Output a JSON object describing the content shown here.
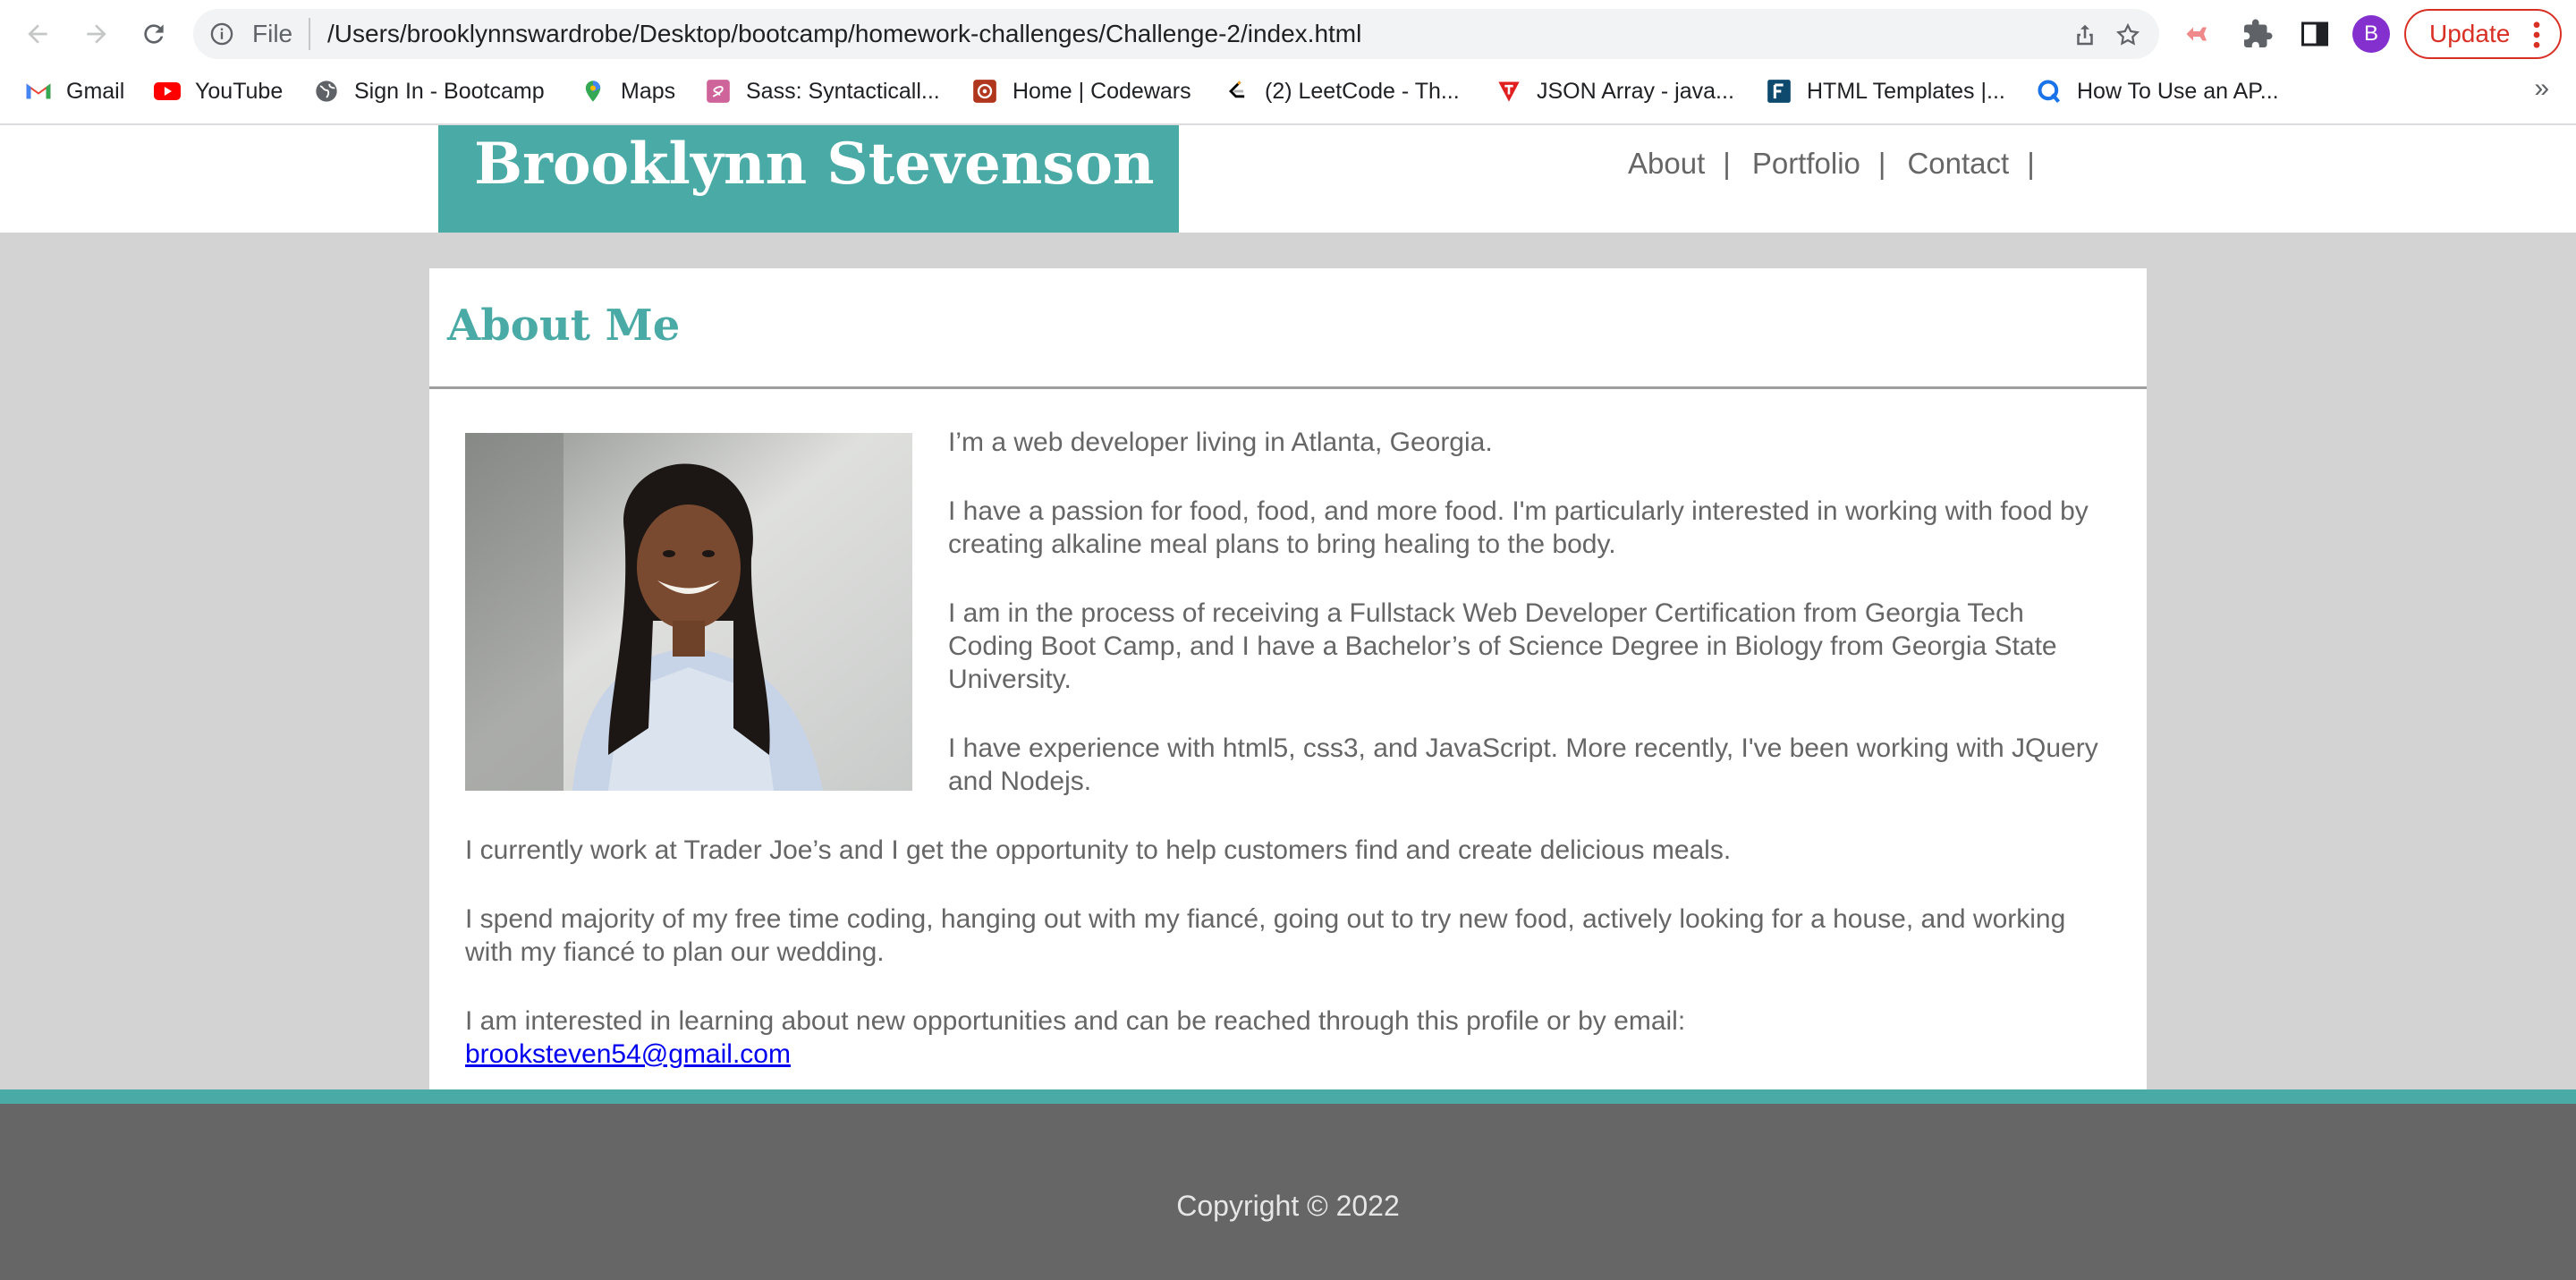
{
  "browser": {
    "scheme": "File",
    "url": "/Users/brooklynnswardrobe/Desktop/bootcamp/homework-challenges/Challenge-2/index.html",
    "profile_initial": "B",
    "update_label": "Update",
    "update_color": "#d93025",
    "bookmarks": [
      {
        "label": "Gmail",
        "icon": "gmail-icon"
      },
      {
        "label": "YouTube",
        "icon": "youtube-icon"
      },
      {
        "label": "Sign In - Bootcamp",
        "icon": "globe-icon"
      },
      {
        "label": "Maps",
        "icon": "maps-icon"
      },
      {
        "label": "Sass: Syntacticall...",
        "icon": "sass-icon"
      },
      {
        "label": "Home | Codewars",
        "icon": "codewars-icon"
      },
      {
        "label": "(2) LeetCode - Th...",
        "icon": "leetcode-icon"
      },
      {
        "label": "JSON Array - java...",
        "icon": "tutorialspoint-icon"
      },
      {
        "label": "HTML Templates |...",
        "icon": "f-icon"
      },
      {
        "label": "How To Use an AP...",
        "icon": "q-icon"
      }
    ],
    "more_bookmarks": "»"
  },
  "site": {
    "name": "Brooklynn Stevenson",
    "accent_color": "#4aaaa5",
    "nav": [
      {
        "label": "About",
        "sep": "|"
      },
      {
        "label": "Portfolio",
        "sep": "|"
      },
      {
        "label": "Contact",
        "sep": "|"
      }
    ]
  },
  "about": {
    "title": "About Me",
    "photo_alt": "profile-photo",
    "paragraphs": [
      "I’m a web developer living in Atlanta, Georgia.",
      "I have a passion for food, food, and more food. I'm particularly interested in working with food by creating alkaline meal plans to bring healing to the body.",
      "I am in the process of receiving a Fullstack Web Developer Certification from Georgia Tech Coding Boot Camp, and I have a Bachelor’s of Science Degree in Biology from Georgia State University.",
      "I have experience with html5, css3, and JavaScript. More recently, I've been working with JQuery and Nodejs.",
      "I currently work at Trader Joe’s and I get the opportunity to help customers find and create delicious meals.",
      "I spend majority of my free time coding, hanging out with my fiancé, going out to try new food, actively looking for a house, and working with my fiancé to plan our wedding.",
      "I am interested in learning about new opportunities and can be reached through this profile or by email:"
    ],
    "email": "brooksteven54@gmail.com"
  },
  "footer": {
    "copyright": "Copyright © 2022"
  }
}
